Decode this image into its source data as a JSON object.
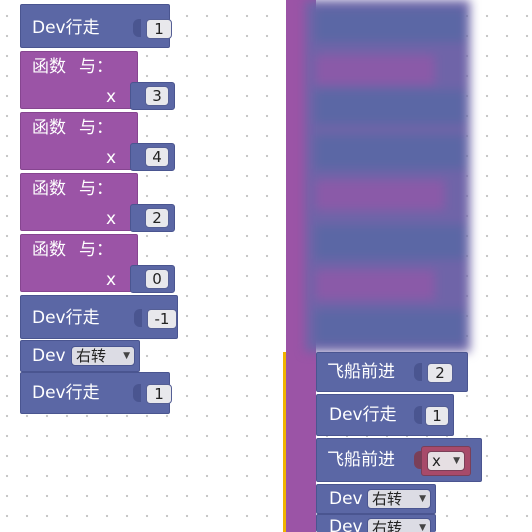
{
  "left_stack": {
    "move1": {
      "label": "Dev行走",
      "value": "1"
    },
    "func_label": "函数",
    "func_with": "与：",
    "func_param": "x",
    "func_values": [
      "3",
      "4",
      "2",
      "0"
    ],
    "move2": {
      "label": "Dev行走",
      "value": "-1"
    },
    "turn1": {
      "label": "Dev",
      "option": "右转"
    },
    "move3": {
      "label": "Dev行走",
      "value": "1"
    }
  },
  "right_stack": {
    "ship1": {
      "label": "飞船前进",
      "value": "2"
    },
    "move": {
      "label": "Dev行走",
      "value": "1"
    },
    "ship2": {
      "label": "飞船前进",
      "variable": "x"
    },
    "turn1": {
      "label": "Dev",
      "option": "右转"
    },
    "turn2": {
      "label": "Dev",
      "option": "右转"
    }
  },
  "colors": {
    "motion_blue": "#5b67a5",
    "function_purple": "#9b54a6",
    "variable_red": "#a84a6a",
    "highlight_yellow": "#f0b400"
  }
}
